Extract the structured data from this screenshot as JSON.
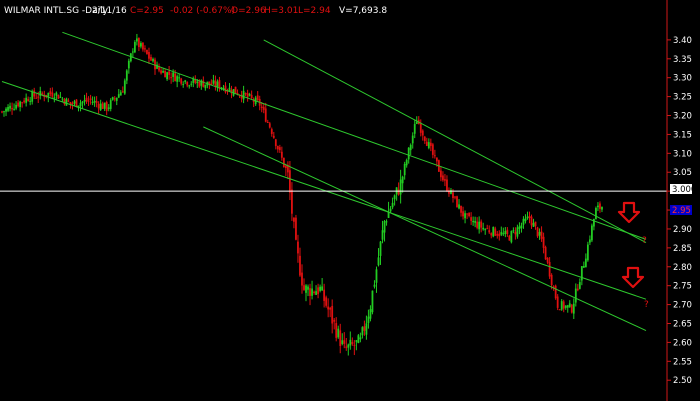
{
  "header": {
    "symbol": "WILMAR INTL.SG -Daily",
    "date": "2/11/16",
    "close": "C=2.95",
    "change": "-0.02 (-0.67%)",
    "open": "O=2.96",
    "high": "H=3.01",
    "low": "L=2.94",
    "volume": "V=7,693.8"
  },
  "colors": {
    "background": "#000000",
    "up_bar": "#22cc22",
    "down_bar": "#e01010",
    "channel_line": "#2ec82e",
    "horizontal_line": "#ffffff",
    "axis": "#d01818",
    "annotation": "#e01010",
    "current_label_bg": "#ffffff",
    "highlight_label_bg": "#0000cc"
  },
  "annotations": {
    "question_marks": [
      "?",
      "?"
    ],
    "arrow_icon": "down-arrow-icon"
  },
  "chart_data": {
    "type": "candlestick",
    "ylim": [
      2.45,
      3.45
    ],
    "y_ticks": [
      "3.40",
      "3.35",
      "3.30",
      "3.25",
      "3.20",
      "3.15",
      "3.10",
      "3.05",
      "3.00",
      "2.95",
      "2.90",
      "2.85",
      "2.80",
      "2.75",
      "2.70",
      "2.65",
      "2.60",
      "2.55",
      "2.50"
    ],
    "current_price_label": "3.000",
    "highlight_label": "2.95",
    "horizontal_level": 3.0,
    "channel_lines": [
      {
        "name": "upper",
        "from_bar": 30,
        "from_price": 3.42,
        "to_bar": 300,
        "to_price": 2.91
      },
      {
        "name": "middle",
        "from_bar": 0,
        "from_price": 3.29,
        "to_bar": 300,
        "to_price": 2.75
      },
      {
        "name": "lower",
        "from_bar": 100,
        "from_price": 3.17,
        "to_bar": 300,
        "to_price": 2.68
      },
      {
        "name": "right-upper",
        "from_bar": 130,
        "from_price": 3.4,
        "to_bar": 300,
        "to_price": 2.92
      }
    ],
    "anchors": [
      [
        0,
        3.21
      ],
      [
        14,
        3.25
      ],
      [
        26,
        3.26
      ],
      [
        34,
        3.23
      ],
      [
        44,
        3.24
      ],
      [
        52,
        3.22
      ],
      [
        60,
        3.27
      ],
      [
        66,
        3.4
      ],
      [
        78,
        3.32
      ],
      [
        92,
        3.29
      ],
      [
        108,
        3.28
      ],
      [
        118,
        3.26
      ],
      [
        128,
        3.23
      ],
      [
        134,
        3.16
      ],
      [
        142,
        3.04
      ],
      [
        146,
        2.85
      ],
      [
        150,
        2.74
      ],
      [
        158,
        2.74
      ],
      [
        164,
        2.66
      ],
      [
        170,
        2.58
      ],
      [
        178,
        2.6
      ],
      [
        183,
        2.7
      ],
      [
        190,
        2.92
      ],
      [
        198,
        3.02
      ],
      [
        206,
        3.19
      ],
      [
        212,
        3.12
      ],
      [
        220,
        3.02
      ],
      [
        230,
        2.93
      ],
      [
        240,
        2.9
      ],
      [
        252,
        2.88
      ],
      [
        262,
        2.93
      ],
      [
        268,
        2.87
      ],
      [
        276,
        2.7
      ],
      [
        283,
        2.69
      ],
      [
        289,
        2.81
      ],
      [
        295,
        2.95
      ],
      [
        298,
        2.96
      ]
    ]
  }
}
